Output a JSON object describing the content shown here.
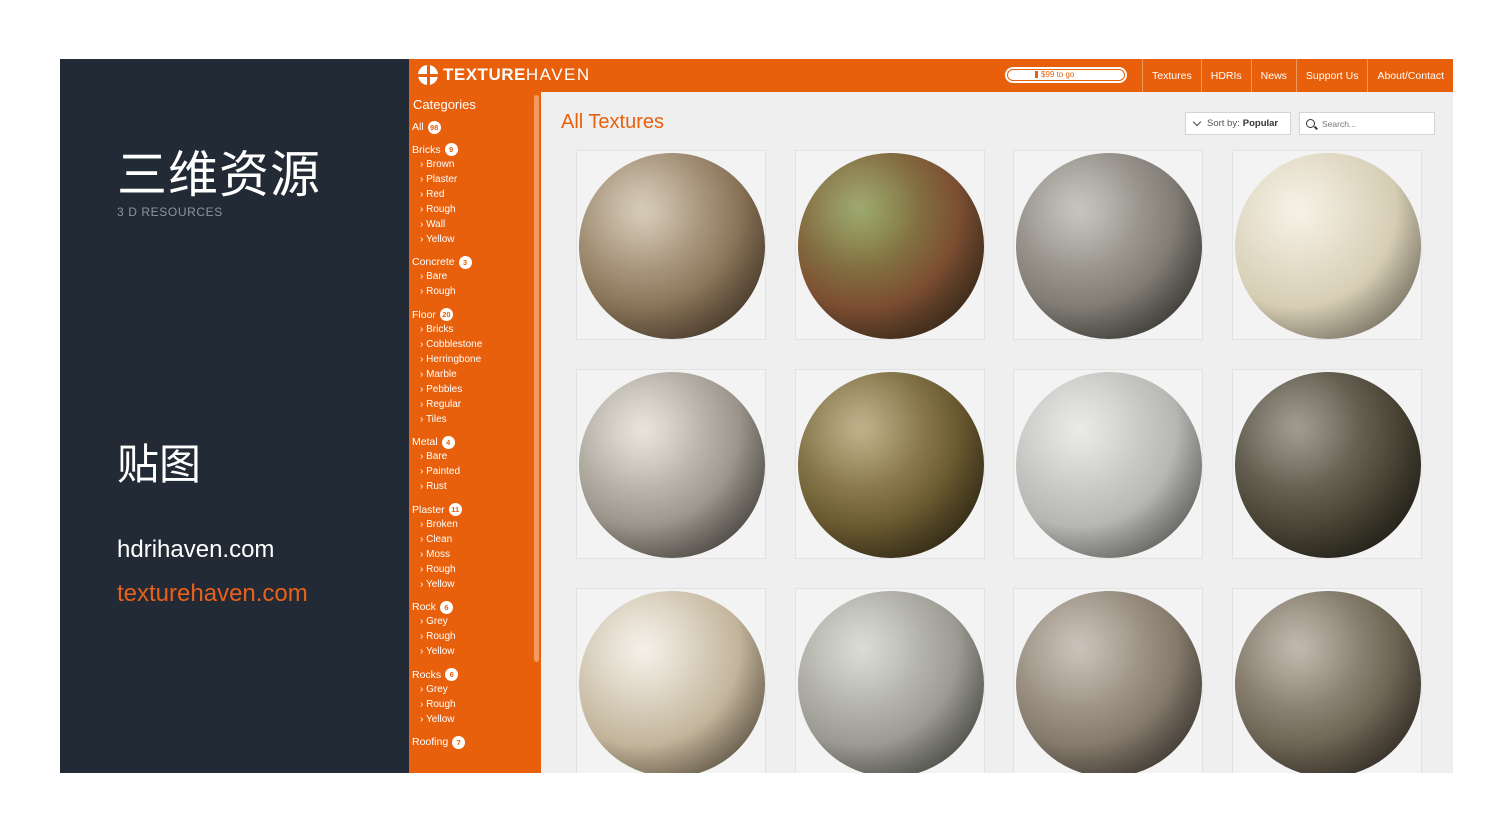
{
  "slide": {
    "title": "三维资源",
    "subtitle": "3 D RESOURCES",
    "section": "贴图",
    "link1": "hdrihaven.com",
    "link2": "texturehaven.com"
  },
  "header": {
    "logo_bold": "TEXTURE",
    "logo_light": "HAVEN",
    "goal_text": "$99 to go",
    "nav": [
      "Textures",
      "HDRIs",
      "News",
      "Support Us",
      "About/Contact"
    ]
  },
  "sidebar": {
    "heading": "Categories",
    "categories": [
      {
        "name": "All",
        "count": "98",
        "subs": []
      },
      {
        "name": "Bricks",
        "count": "9",
        "subs": [
          "Brown",
          "Plaster",
          "Red",
          "Rough",
          "Wall",
          "Yellow"
        ]
      },
      {
        "name": "Concrete",
        "count": "3",
        "subs": [
          "Bare",
          "Rough"
        ]
      },
      {
        "name": "Floor",
        "count": "20",
        "subs": [
          "Bricks",
          "Cobblestone",
          "Herringbone",
          "Marble",
          "Pebbles",
          "Regular",
          "Tiles"
        ]
      },
      {
        "name": "Metal",
        "count": "4",
        "subs": [
          "Bare",
          "Painted",
          "Rust"
        ]
      },
      {
        "name": "Plaster",
        "count": "11",
        "subs": [
          "Broken",
          "Clean",
          "Moss",
          "Rough",
          "Yellow"
        ]
      },
      {
        "name": "Rock",
        "count": "6",
        "subs": [
          "Grey",
          "Rough",
          "Yellow"
        ]
      },
      {
        "name": "Rocks",
        "count": "6",
        "subs": [
          "Grey",
          "Rough",
          "Yellow"
        ]
      },
      {
        "name": "Roofing",
        "count": "7",
        "subs": []
      }
    ]
  },
  "main": {
    "title": "All Textures",
    "sort_label": "Sort by:",
    "sort_value": "Popular",
    "search_placeholder": "Search..."
  },
  "colors": {
    "accent": "#e8600c",
    "slide_bg": "#222a35",
    "site_bg": "#efefef"
  },
  "textures": [
    {
      "name": "stone-rubble-sphere",
      "c1": "#c8b9a0",
      "c2": "#8a7458",
      "c3": "#4a3b2b"
    },
    {
      "name": "moss-ground-sphere",
      "c1": "#7a8a3a",
      "c2": "#7c4e32",
      "c3": "#2f2a16"
    },
    {
      "name": "grey-brick-sphere",
      "c1": "#b4b0a8",
      "c2": "#807c74",
      "c3": "#3a3834"
    },
    {
      "name": "cream-tile-sphere",
      "c1": "#f2ecdc",
      "c2": "#d6cdb4",
      "c3": "#8e8672"
    },
    {
      "name": "limestone-brick-sphere",
      "c1": "#e0dbd0",
      "c2": "#9a948a",
      "c3": "#4a4640"
    },
    {
      "name": "bark-olive-sphere",
      "c1": "#a89660",
      "c2": "#6a5a30",
      "c3": "#2c2412"
    },
    {
      "name": "plaster-grey-sphere",
      "c1": "#e2e2e0",
      "c2": "#b6b6b2",
      "c3": "#6a6a66"
    },
    {
      "name": "bark-mossy-sphere",
      "c1": "#7d7868",
      "c2": "#4a4536",
      "c3": "#1e1c14"
    },
    {
      "name": "rough-rock-sphere",
      "c1": "#f0ebe0",
      "c2": "#c2b49a",
      "c3": "#6a5c46"
    },
    {
      "name": "concrete-sphere",
      "c1": "#cfcfc8",
      "c2": "#9a9a92",
      "c3": "#505048"
    },
    {
      "name": "wood-planks-sphere",
      "c1": "#b8ada0",
      "c2": "#857a6c",
      "c3": "#3e3830"
    },
    {
      "name": "wood-boards-sphere",
      "c1": "#aaa090",
      "c2": "#6e6454",
      "c3": "#302a22"
    }
  ]
}
